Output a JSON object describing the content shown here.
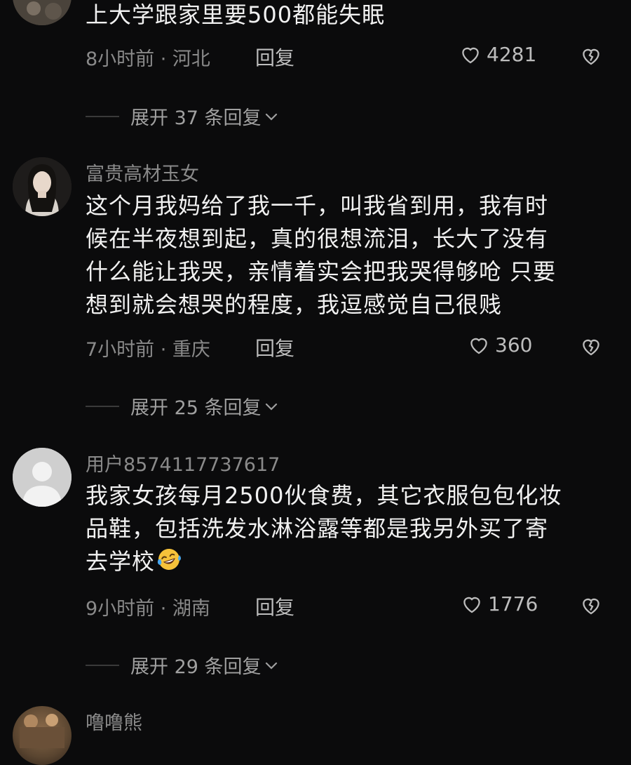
{
  "comments": [
    {
      "username": "",
      "lines": [
        "上大学跟家里要500都能失眠"
      ],
      "time_location": "8小时前 · 河北",
      "reply_label": "回复",
      "likes": "4281",
      "expand_label": "展开 37 条回复"
    },
    {
      "username": "富贵高材玉女",
      "lines": [
        "这个月我妈给了我一千，叫我省到用，我有时",
        "候在半夜想到起，真的很想流泪，长大了没有",
        "什么能让我哭，亲情着实会把我哭得够呛 只要",
        "想到就会想哭的程度，我逗感觉自己很贱"
      ],
      "time_location": "7小时前 · 重庆",
      "reply_label": "回复",
      "likes": "360",
      "expand_label": "展开 25 条回复"
    },
    {
      "username": "用户8574117737617",
      "lines": [
        "我家女孩每月2500伙食费，其它衣服包包化妆",
        "品鞋，包括洗发水淋浴露等都是我另外买了寄",
        "去学校"
      ],
      "emoji": "laughing-tears-emoji",
      "time_location": "9小时前 · 湖南",
      "reply_label": "回复",
      "likes": "1776",
      "expand_label": "展开 29 条回复"
    },
    {
      "username": "噜噜熊"
    }
  ],
  "icons": {
    "like": "heart-outline-icon",
    "dislike": "broken-heart-icon",
    "expand": "chevron-down-icon"
  },
  "colors": {
    "background": "#0b0b0c",
    "text_primary": "#f1f1f1",
    "text_secondary": "#8a8a8a",
    "accent_emoji": "#f6c23a"
  }
}
